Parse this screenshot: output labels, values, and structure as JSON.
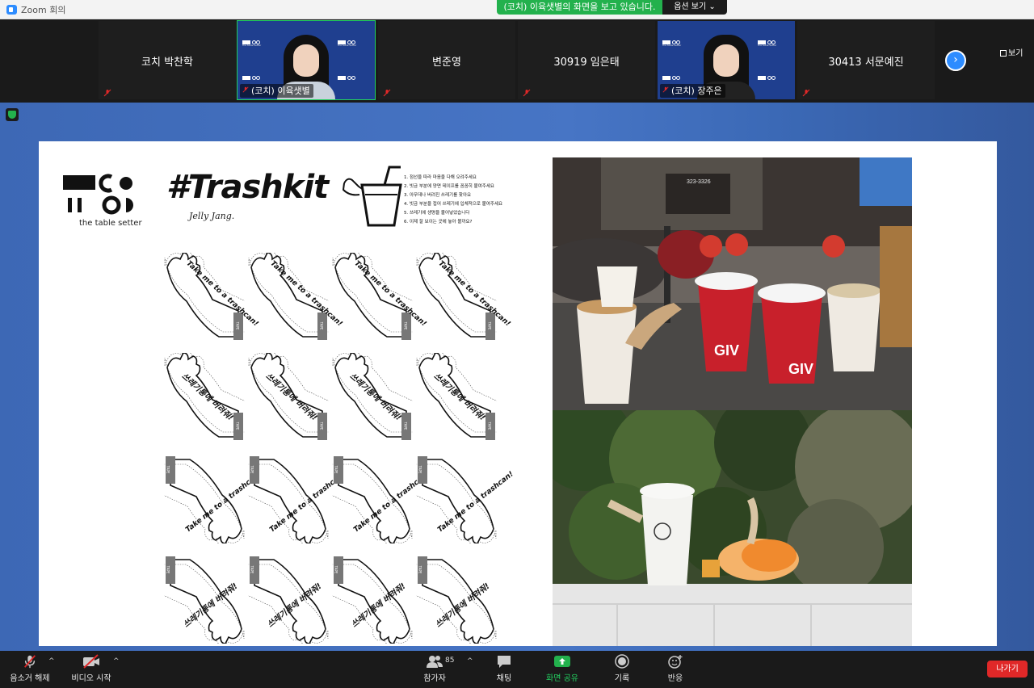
{
  "window": {
    "title": "Zoom 회의"
  },
  "banner": {
    "text": "(코치) 이육샛별의 화면을 보고 있습니다.",
    "options_label": "옵션 보기 ⌄"
  },
  "gallery": {
    "tiles": [
      {
        "name": "코치 박찬학"
      },
      {
        "name": "(코치) 이육샛별"
      },
      {
        "name": "변준영"
      },
      {
        "name": "30919 임은태"
      },
      {
        "name": "(코치) 장주은"
      },
      {
        "name": "30413  서문예진"
      }
    ],
    "view_label": "보기",
    "logo_caption": "the table setter"
  },
  "slide": {
    "brand_caption": "the table setter",
    "title": "#Trashkit",
    "author": "Jelly Jang.",
    "steps": [
      "1. 점선을 따라 마음을 다해 오려주세요",
      "2. 빗금 부분에 양면 테이프를 꼼꼼히 붙여주세요",
      "3. 아무데나 버려진 쓰레기를 찾아요",
      "4. 빗금 부분을 접어 쓰레기에 입체적으로 붙여주세요",
      "5. 쓰레기에 생명을 불어넣었습니다",
      "6. 이제 잘 보이는 곳에 놓아 볼까요?"
    ],
    "sticker_en": "Take me to a trashcan!",
    "sticker_ko": "쓰레기통에 버려줘!",
    "sticker_tape": "TAPE",
    "photo_text": [
      "GIV",
      "GIV",
      "323-3326"
    ]
  },
  "toolbar": {
    "mute_label": "음소거 해제",
    "video_label": "비디오 시작",
    "participants_label": "참가자",
    "participants_count": "85",
    "chat_label": "채팅",
    "share_label": "화면 공유",
    "record_label": "기록",
    "reactions_label": "반응",
    "leave_label": "나가기"
  },
  "colors": {
    "share_green": "#23b14d",
    "zoom_blue": "#2d8cff",
    "leave_red": "#e02828"
  }
}
